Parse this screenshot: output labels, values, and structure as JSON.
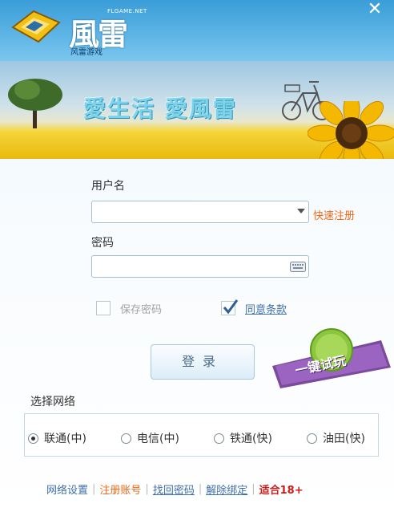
{
  "header": {
    "brand_main": "風雷",
    "brand_url": "FLGAME.NET",
    "brand_sub": "风雷游戏",
    "close_glyph": "✕"
  },
  "banner": {
    "slogan": "愛生活 愛風雷"
  },
  "form": {
    "username_label": "用户名",
    "username_value": "",
    "quick_register": "快速注册",
    "password_label": "密码",
    "password_value": "",
    "remember_label": "保存密码",
    "remember_checked": false,
    "agree_label": "同意条款",
    "agree_checked": true,
    "login_label": "登录",
    "trial_label": "一键试玩"
  },
  "network": {
    "title": "选择网络",
    "options": [
      {
        "label": "联通(中)",
        "selected": true
      },
      {
        "label": "电信(中)",
        "selected": false
      },
      {
        "label": "铁通(快)",
        "selected": false
      },
      {
        "label": "油田(快)",
        "selected": false
      }
    ]
  },
  "footer": {
    "net_settings": "网络设置",
    "register": "注册账号",
    "recover": "找回密码",
    "unbind": "解除绑定",
    "age": "适合18+"
  },
  "colors": {
    "header_blue": "#4aa8e0",
    "accent_orange": "#f06a1a",
    "link_blue": "#3f6fa8",
    "age_red": "#d11b1b"
  }
}
